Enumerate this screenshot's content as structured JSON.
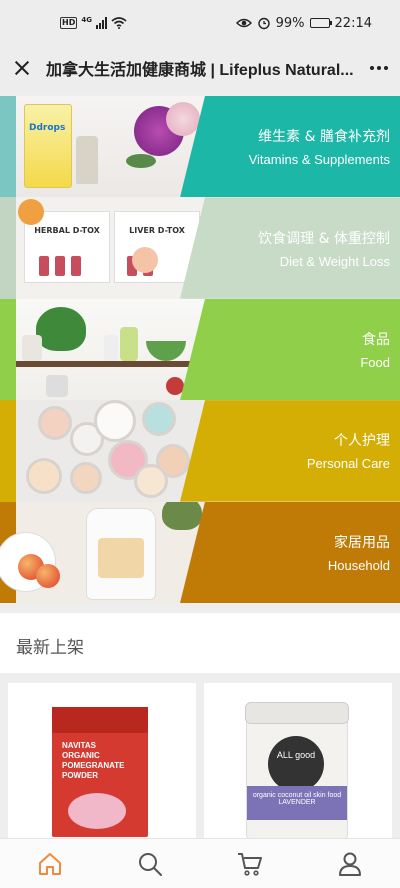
{
  "status_bar": {
    "network_badge": "HD",
    "network_type": "4G",
    "battery": "99%",
    "time": "22:14",
    "icons": [
      "signal-icon",
      "wifi-icon",
      "eye-icon",
      "alarm-icon",
      "battery-icon"
    ]
  },
  "title_bar": {
    "title": "加拿大生活加健康商城 | Lifeplus Natural...",
    "close_icon": "close-icon",
    "more_icon": "more-icon"
  },
  "categories": [
    {
      "zh": "维生素 & 膳食补充剂",
      "en": "Vitamins & Supplements",
      "color": "#1cb7a6",
      "strip": "#7bc6c2"
    },
    {
      "zh": "饮食调理 & 体重控制",
      "en": "Diet & Weight Loss",
      "color": "#c7dbc7",
      "strip": "#c2d4c2"
    },
    {
      "zh": "食品",
      "en": "Food",
      "color": "#8fcf4a",
      "strip": "#8fcf4a"
    },
    {
      "zh": "个人护理",
      "en": "Personal Care",
      "color": "#d4ae05",
      "strip": "#d4ae05"
    },
    {
      "zh": "家居用品",
      "en": "Household",
      "color": "#c07b06",
      "strip": "#c07b06"
    }
  ],
  "photo_labels": {
    "drops": "Ddrops",
    "herbal": "HERBAL D-TOX",
    "liver": "LIVER D-TOX",
    "navitas": "NAVITAS",
    "pouch_text": "ORGANIC POMEGRANATE POWDER",
    "coconut_brand": "ALL good",
    "coconut_text": "organic coconut oil skin food",
    "coconut_variant": "LAVENDER"
  },
  "new_arrivals": {
    "title": "最新上架"
  },
  "bottom_nav": [
    {
      "name": "home",
      "icon": "home-icon",
      "color": "#f08a3c"
    },
    {
      "name": "search",
      "icon": "search-icon",
      "color": "#555555"
    },
    {
      "name": "cart",
      "icon": "cart-icon",
      "color": "#555555"
    },
    {
      "name": "profile",
      "icon": "profile-icon",
      "color": "#555555"
    }
  ]
}
